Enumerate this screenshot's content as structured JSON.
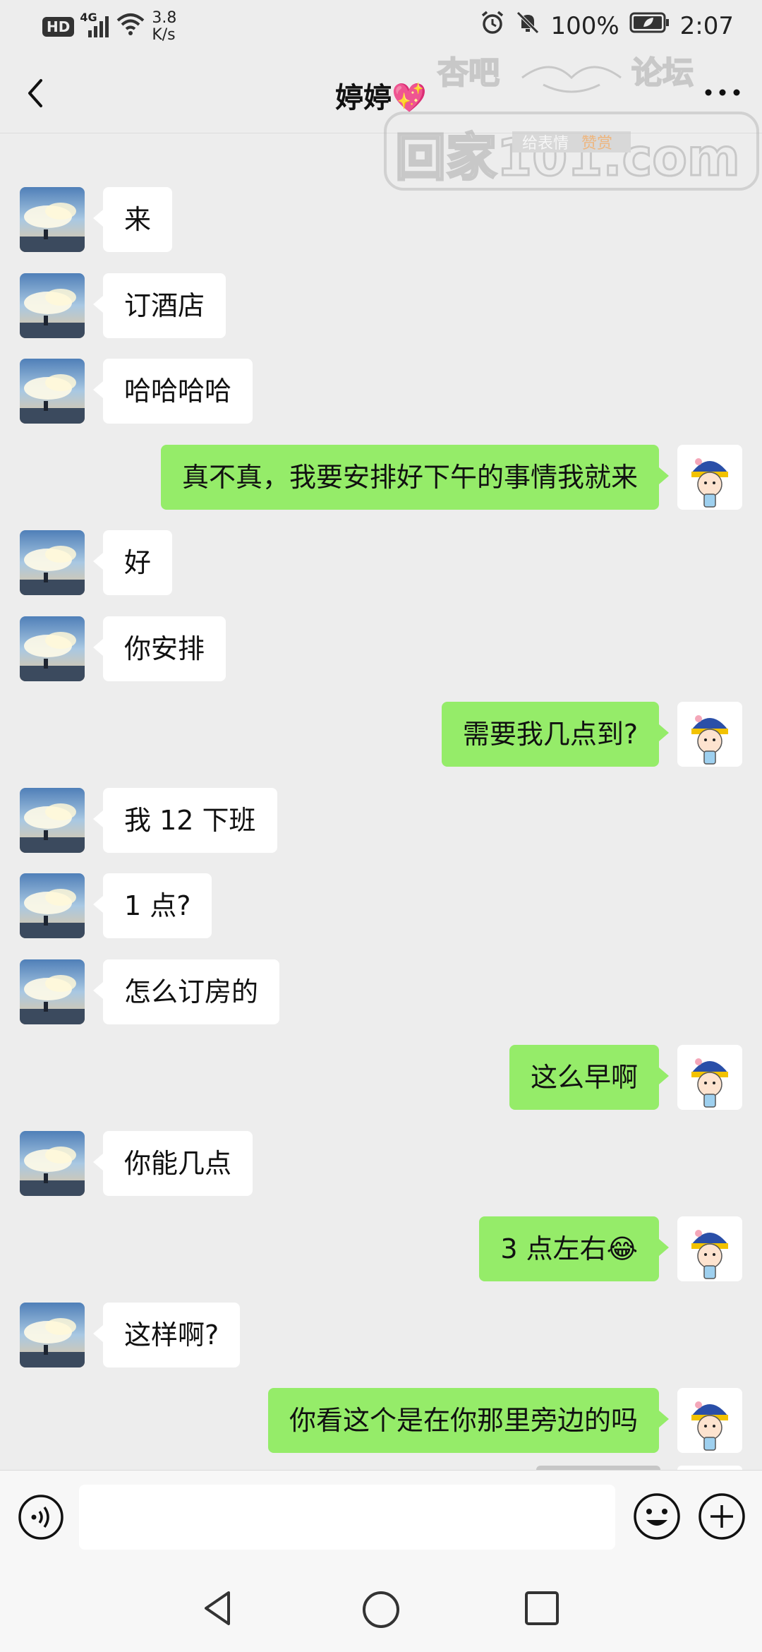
{
  "status_bar": {
    "hd": "HD",
    "network": "4G",
    "speed_value": "3.8",
    "speed_unit": "K/s",
    "battery": "100%",
    "time": "2:07"
  },
  "header": {
    "title": "婷婷💖"
  },
  "watermark": {
    "line1_left": "杏吧",
    "line1_right": "论坛",
    "line2": "回家101.com",
    "tag_gray": "给表情",
    "tag_orange": "赞赏"
  },
  "messages": [
    {
      "side": "left",
      "text": "来"
    },
    {
      "side": "left",
      "text": "订酒店"
    },
    {
      "side": "left",
      "text": "哈哈哈哈"
    },
    {
      "side": "right",
      "text": "真不真，我要安排好下午的事情我就来"
    },
    {
      "side": "left",
      "text": "好"
    },
    {
      "side": "left",
      "text": "你安排"
    },
    {
      "side": "right",
      "text": "需要我几点到?"
    },
    {
      "side": "left",
      "text": "我 12 下班"
    },
    {
      "side": "left",
      "text": "1 点?"
    },
    {
      "side": "left",
      "text": "怎么订房的"
    },
    {
      "side": "right",
      "text": "这么早啊"
    },
    {
      "side": "left",
      "text": "你能几点"
    },
    {
      "side": "right",
      "text": "3 点左右😂"
    },
    {
      "side": "left",
      "text": "这样啊?"
    },
    {
      "side": "right",
      "text": "你看这个是在你那里旁边的吗"
    }
  ],
  "input": {
    "placeholder": ""
  },
  "icons": {
    "back": "chevron-left-icon",
    "more": "more-dots-icon",
    "voice": "voice-icon",
    "emoji": "emoji-icon",
    "plus": "plus-icon",
    "nav_back": "nav-back-icon",
    "nav_home": "nav-home-icon",
    "nav_recent": "nav-recent-icon"
  },
  "colors": {
    "background": "#ededed",
    "bubble_self": "#95ec69",
    "bubble_other": "#ffffff"
  }
}
